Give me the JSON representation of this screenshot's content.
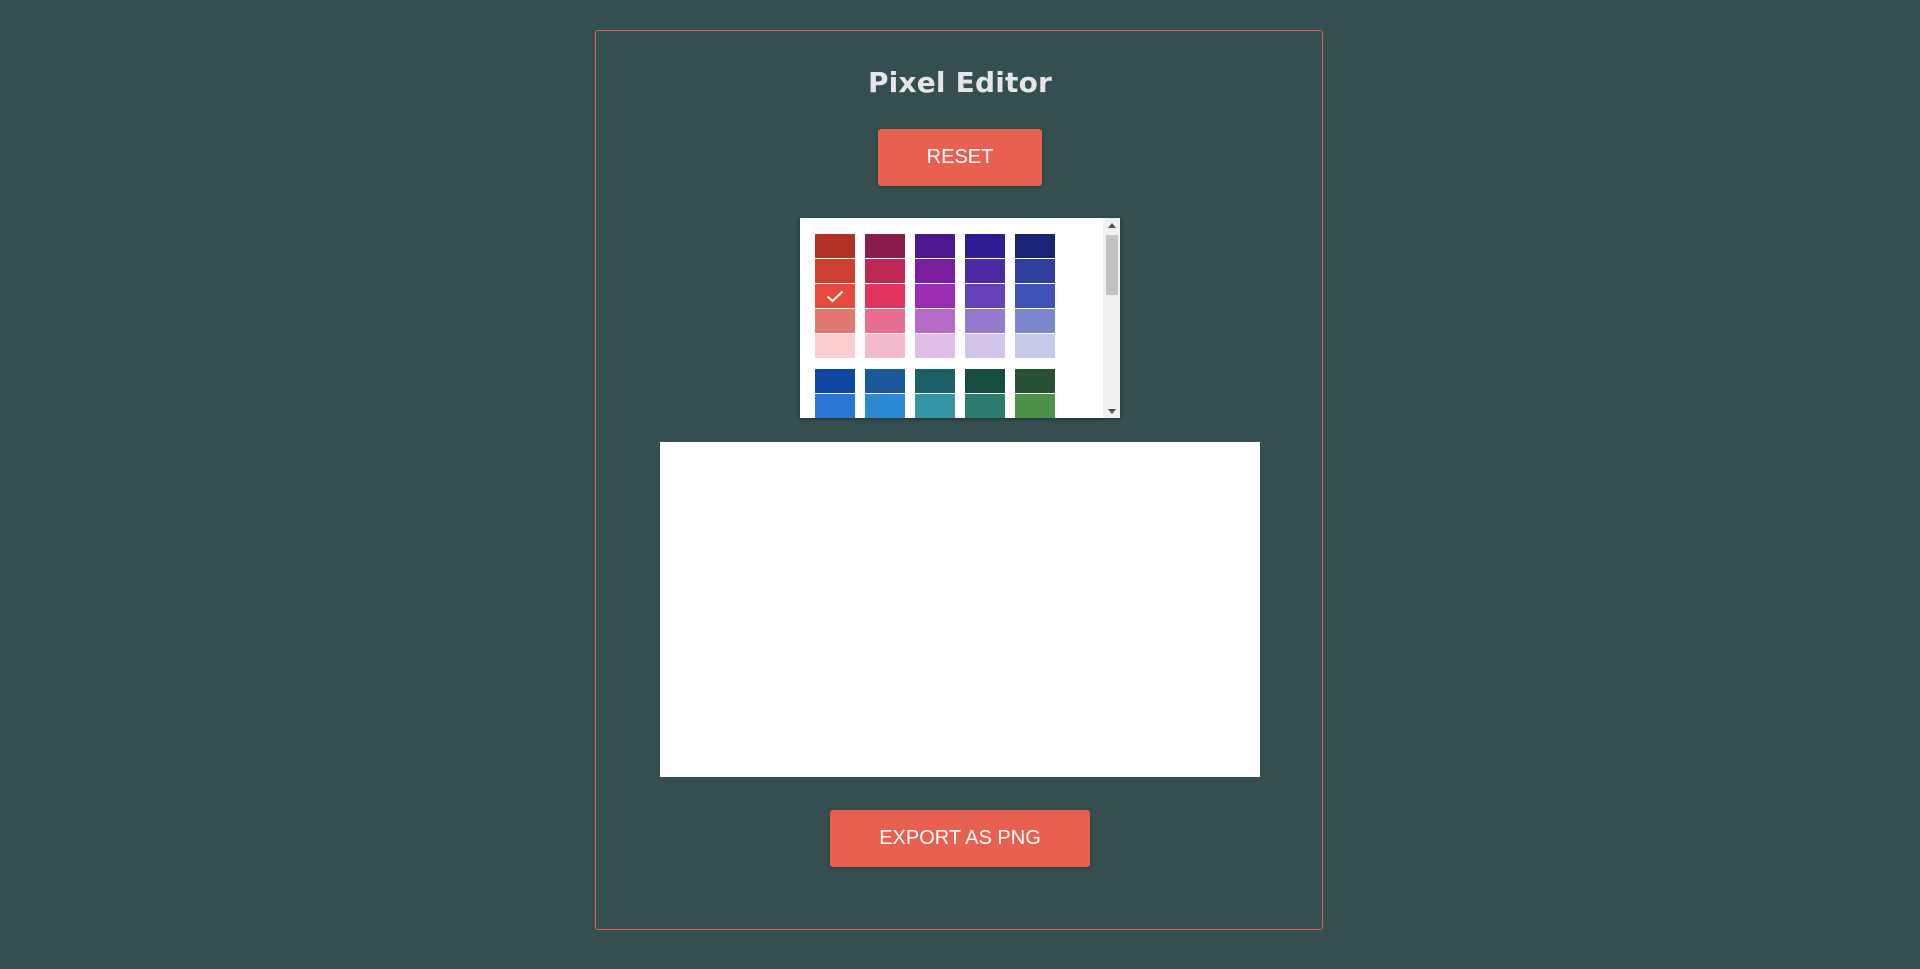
{
  "app": {
    "title": "Pixel Editor"
  },
  "buttons": {
    "reset_label": "RESET",
    "export_label": "EXPORT AS PNG"
  },
  "colors": {
    "background": "#354e50",
    "accent": "#e8604f",
    "title_text": "#e6e6e6",
    "canvas": "#ffffff"
  },
  "palette": {
    "selected": "#e64a3c",
    "groups": [
      [
        [
          "#b03227",
          "#cc3f31",
          "#e64a3c",
          "#e0786f",
          "#fbcdd0"
        ],
        [
          "#891c4b",
          "#bc2754",
          "#e13260",
          "#e86e91",
          "#f3bacc"
        ],
        [
          "#4c1791",
          "#7a1fa2",
          "#9b2db3",
          "#b66bc8",
          "#e0bde7"
        ],
        [
          "#311b92",
          "#4c2aa3",
          "#6441b7",
          "#9579cd",
          "#d1c4e8"
        ],
        [
          "#192377",
          "#303e9e",
          "#3f52b5",
          "#7c86cc",
          "#c5cae9"
        ]
      ],
      [
        [
          "#0d47a1",
          "#2b76d2"
        ],
        [
          "#1a5a9a",
          "#2b8ad3"
        ],
        [
          "#1b6167",
          "#3496a5"
        ],
        [
          "#174d40",
          "#2b7c6c"
        ],
        [
          "#275135",
          "#4d9148"
        ]
      ]
    ]
  }
}
